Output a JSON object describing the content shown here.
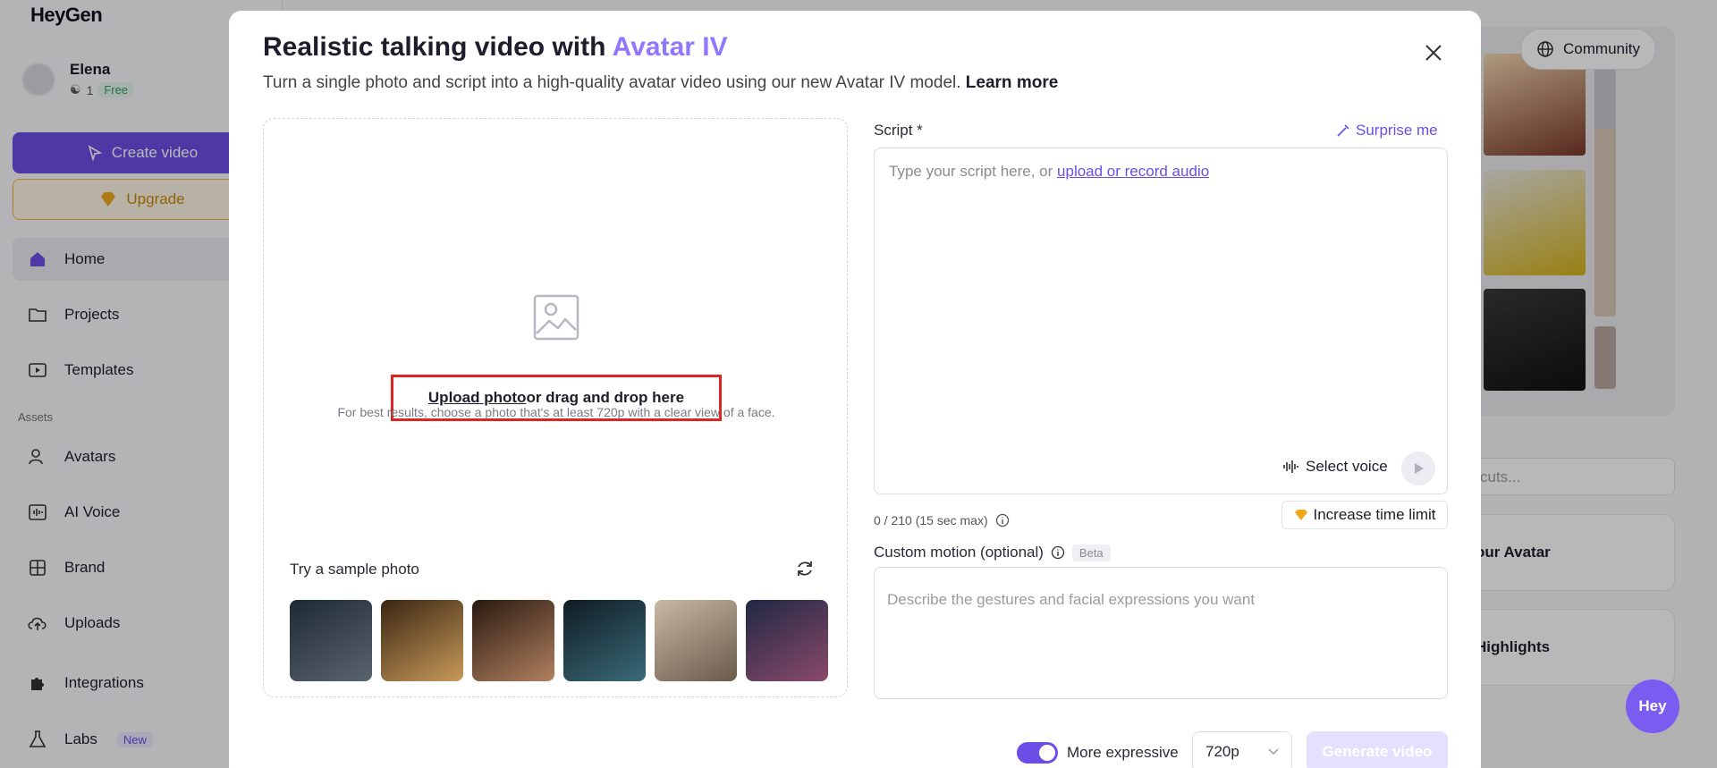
{
  "app": {
    "logo": "HeyGen"
  },
  "user": {
    "name": "Elena",
    "count": "1",
    "plan": "Free"
  },
  "sidebar": {
    "create_label": "Create video",
    "upgrade_label": "Upgrade",
    "assets_label": "Assets",
    "items": [
      {
        "label": "Home",
        "icon": "home-icon"
      },
      {
        "label": "Projects",
        "icon": "folder-icon"
      },
      {
        "label": "Templates",
        "icon": "film-icon"
      },
      {
        "label": "Avatars",
        "icon": "avatar-icon"
      },
      {
        "label": "AI Voice",
        "icon": "voice-icon"
      },
      {
        "label": "Brand",
        "icon": "brand-icon"
      },
      {
        "label": "Uploads",
        "icon": "upload-cloud-icon"
      },
      {
        "label": "Integrations",
        "icon": "puzzle-icon"
      },
      {
        "label": "Labs",
        "icon": "flask-icon",
        "badge": "New"
      }
    ]
  },
  "background": {
    "community_label": "Community",
    "shortcuts_partial": "cuts...",
    "avatar_card_partial": "our Avatar",
    "highlights_partial": "Highlights"
  },
  "modal": {
    "title_prefix": "Realistic talking video with ",
    "title_accent": "Avatar IV",
    "subtitle": "Turn a single photo and script into a high-quality avatar video using our new Avatar IV model. ",
    "learn_more": "Learn more",
    "upload": {
      "link_label": "Upload photo",
      "rest_label": " or drag and drop here",
      "hint": "For best results, choose a photo that's at least 720p with a clear view of a face.",
      "sample_label": "Try a sample photo",
      "samples": [
        {
          "colors": [
            "#1e2a33",
            "#5a6470"
          ]
        },
        {
          "colors": [
            "#3a2612",
            "#c89a5a"
          ]
        },
        {
          "colors": [
            "#2a1a10",
            "#b08060"
          ]
        },
        {
          "colors": [
            "#101c24",
            "#3a6a78"
          ]
        },
        {
          "colors": [
            "#c8b8a4",
            "#6a5a4a"
          ]
        },
        {
          "colors": [
            "#202844",
            "#8a4a6a"
          ]
        }
      ]
    },
    "script": {
      "label": "Script *",
      "surprise_label": "Surprise me",
      "placeholder_prefix": "Type your script here, or ",
      "placeholder_link": "upload or record audio",
      "voice_label": "Select voice",
      "counter": "0 / 210 (15 sec max)",
      "time_limit_label": "Increase time limit"
    },
    "motion": {
      "label": "Custom motion (optional)",
      "badge": "Beta",
      "placeholder": "Describe the gestures and facial expressions you want"
    },
    "footer": {
      "toggle_label": "More expressive",
      "toggle_on": true,
      "resolution": "720p",
      "generate_label": "Generate video"
    }
  },
  "fab_label": "Hey",
  "colors": {
    "accent": "#6b4ee6",
    "accent_light": "#8f77ff",
    "highlight": "#e02424",
    "upgrade": "#f0b541"
  }
}
